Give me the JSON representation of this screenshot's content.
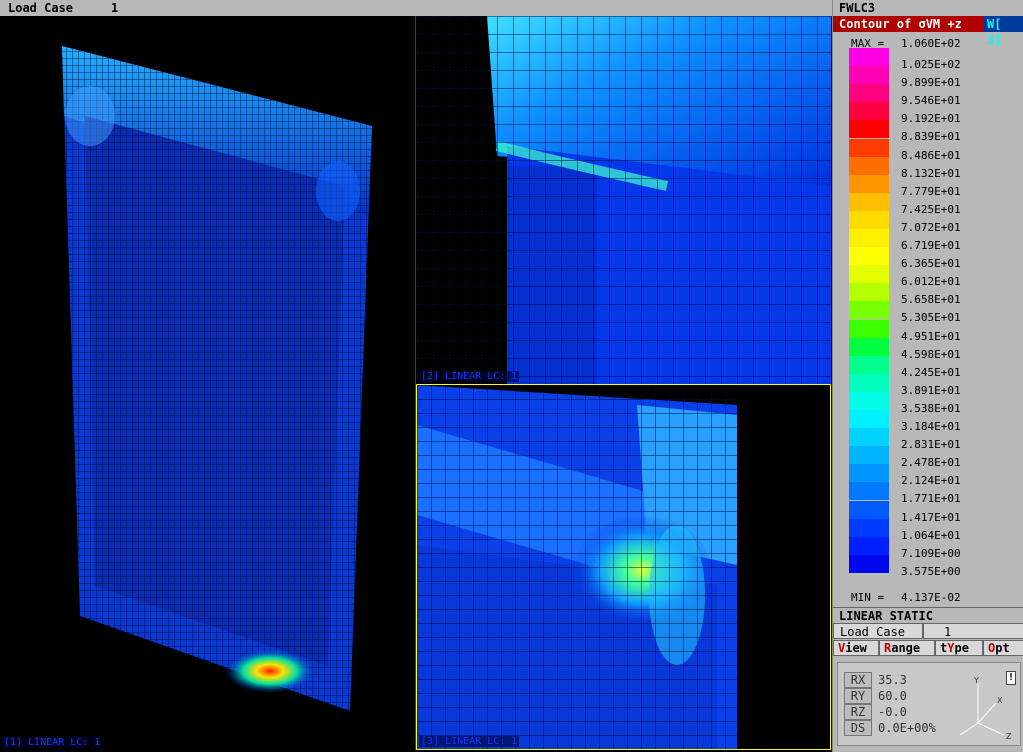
{
  "topbar": {
    "label": "Load Case",
    "number": "1"
  },
  "panel": {
    "title": "FWLC3",
    "contour_title": "Contour of σVM +z",
    "window_tag": "W[ 3]",
    "legend": {
      "max_tag": "MAX =",
      "min_tag": "MIN =",
      "max_value": "1.060E+02",
      "min_value": "4.137E-02",
      "values": [
        "1.025E+02",
        "9.899E+01",
        "9.546E+01",
        "9.192E+01",
        "8.839E+01",
        "8.486E+01",
        "8.132E+01",
        "7.779E+01",
        "7.425E+01",
        "7.072E+01",
        "6.719E+01",
        "6.365E+01",
        "6.012E+01",
        "5.658E+01",
        "5.305E+01",
        "4.951E+01",
        "4.598E+01",
        "4.245E+01",
        "3.891E+01",
        "3.538E+01",
        "3.184E+01",
        "2.831E+01",
        "2.478E+01",
        "2.124E+01",
        "1.771E+01",
        "1.417E+01",
        "1.064E+01",
        "7.109E+00",
        "3.575E+00"
      ],
      "colors": [
        "#ff00e6",
        "#ff00b4",
        "#ff0080",
        "#ff0040",
        "#ff0000",
        "#ff3c00",
        "#ff6e00",
        "#ff9600",
        "#ffbe00",
        "#ffdc00",
        "#fff000",
        "#ffff00",
        "#e6ff00",
        "#b4ff00",
        "#78ff00",
        "#3cff00",
        "#00ff3c",
        "#00ff8c",
        "#00ffbe",
        "#00ffe6",
        "#00f0ff",
        "#00d2ff",
        "#00b4ff",
        "#0096ff",
        "#0078ff",
        "#005aff",
        "#003cff",
        "#0020ff",
        "#0008f0"
      ]
    },
    "analysis": "LINEAR STATIC",
    "load_case": {
      "label": "Load Case",
      "value": "1"
    },
    "menu": [
      {
        "key": "V",
        "rest": "iew"
      },
      {
        "key": "R",
        "rest": "ange"
      },
      {
        "pre": "t",
        "key": "Y",
        "rest": "pe"
      },
      {
        "key": "O",
        "rest": "pt"
      }
    ],
    "view": {
      "rx": {
        "label": "RX",
        "value": "35.3"
      },
      "ry": {
        "label": "RY",
        "value": "60.0"
      },
      "rz": {
        "label": "RZ",
        "value": "-0.0"
      },
      "ds": {
        "label": "DS",
        "value": "0.0E+00%"
      }
    }
  },
  "viewports": [
    {
      "label": "[1] LINEAR LC: 1"
    },
    {
      "label": "[2] LINEAR LC: 1"
    },
    {
      "label": "[3] LINEAR LC: 1"
    }
  ]
}
